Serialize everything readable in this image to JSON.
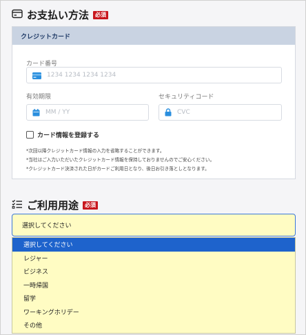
{
  "payment": {
    "title": "お支払い方法",
    "required_badge": "必須",
    "card_tab": "クレジットカード",
    "card_number_label": "カード番号",
    "card_number_placeholder": "1234 1234 1234 1234",
    "expiry_label": "有効期限",
    "expiry_placeholder": "MM / YY",
    "security_label": "セキュリティコード",
    "security_placeholder": "CVC",
    "save_card_label": "カード情報を登録する",
    "notes": [
      "*次回以降クレジットカード情報の入力を省略することができます。",
      "*当社はご入力いただいたクレジットカード情報を保持しておりませんのでご安心ください。",
      "*クレジットカード決済された日がカードご利用日となり、後日お引き落としとなります。"
    ]
  },
  "usage": {
    "title": "ご利用用途",
    "required_badge": "必須",
    "selected_value": "選択してください",
    "options": [
      "選択してください",
      "レジャー",
      "ビジネス",
      "一時帰国",
      "留学",
      "ワーキングホリデー",
      "その他"
    ]
  }
}
